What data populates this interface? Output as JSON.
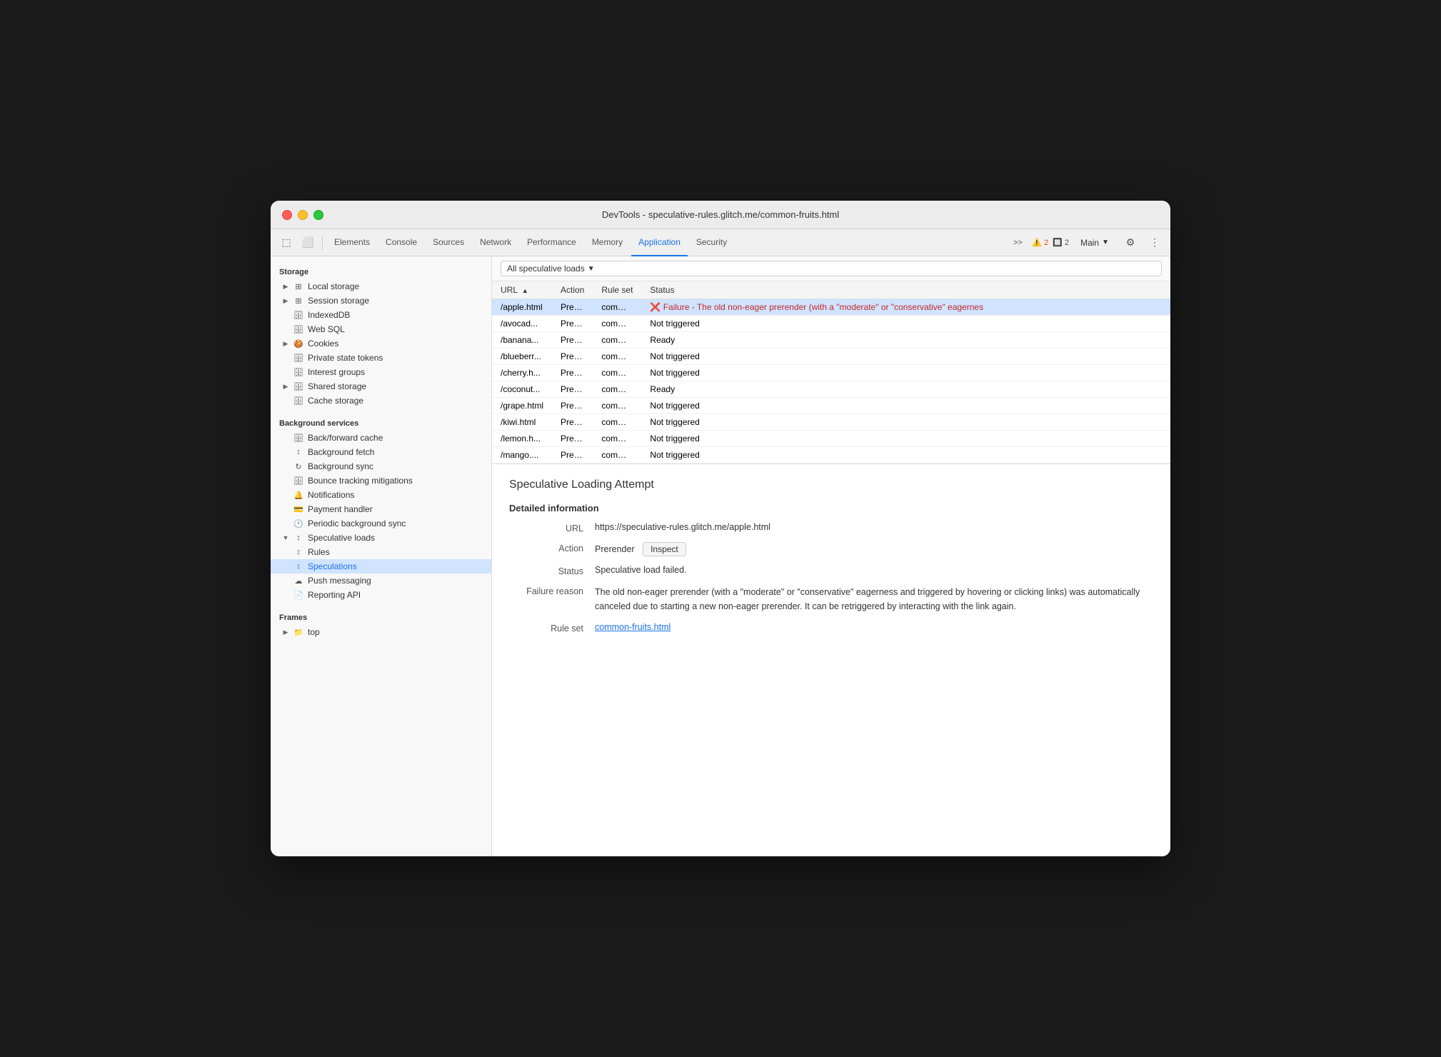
{
  "window": {
    "title": "DevTools - speculative-rules.glitch.me/common-fruits.html"
  },
  "toolbar": {
    "tabs": [
      {
        "id": "elements",
        "label": "Elements",
        "active": false
      },
      {
        "id": "console",
        "label": "Console",
        "active": false
      },
      {
        "id": "sources",
        "label": "Sources",
        "active": false
      },
      {
        "id": "network",
        "label": "Network",
        "active": false
      },
      {
        "id": "performance",
        "label": "Performance",
        "active": false
      },
      {
        "id": "memory",
        "label": "Memory",
        "active": false
      },
      {
        "id": "application",
        "label": "Application",
        "active": true
      },
      {
        "id": "security",
        "label": "Security",
        "active": false
      }
    ],
    "warnings_count": "2",
    "info_count": "2",
    "main_label": "Main",
    "more_tabs_label": ">>"
  },
  "sidebar": {
    "storage_header": "Storage",
    "background_services_header": "Background services",
    "frames_header": "Frames",
    "items": [
      {
        "id": "local-storage",
        "label": "Local storage",
        "icon": "table",
        "expandable": true,
        "indent": 0
      },
      {
        "id": "session-storage",
        "label": "Session storage",
        "icon": "table",
        "expandable": true,
        "indent": 0
      },
      {
        "id": "indexeddb",
        "label": "IndexedDB",
        "icon": "cylinder",
        "expandable": false,
        "indent": 0
      },
      {
        "id": "web-sql",
        "label": "Web SQL",
        "icon": "cylinder",
        "expandable": false,
        "indent": 0
      },
      {
        "id": "cookies",
        "label": "Cookies",
        "icon": "cookie",
        "expandable": true,
        "indent": 0
      },
      {
        "id": "private-state-tokens",
        "label": "Private state tokens",
        "icon": "cylinder",
        "expandable": false,
        "indent": 0
      },
      {
        "id": "interest-groups",
        "label": "Interest groups",
        "icon": "cylinder",
        "expandable": false,
        "indent": 0
      },
      {
        "id": "shared-storage",
        "label": "Shared storage",
        "icon": "cylinder",
        "expandable": true,
        "indent": 0
      },
      {
        "id": "cache-storage",
        "label": "Cache storage",
        "icon": "cylinder",
        "expandable": false,
        "indent": 0
      },
      {
        "id": "back-forward-cache",
        "label": "Back/forward cache",
        "icon": "cylinder",
        "indent": 0
      },
      {
        "id": "background-fetch",
        "label": "Background fetch",
        "icon": "arrow-up-down",
        "indent": 0
      },
      {
        "id": "background-sync",
        "label": "Background sync",
        "icon": "refresh",
        "indent": 0
      },
      {
        "id": "bounce-tracking",
        "label": "Bounce tracking mitigations",
        "icon": "cylinder",
        "indent": 0
      },
      {
        "id": "notifications",
        "label": "Notifications",
        "icon": "bell",
        "indent": 0
      },
      {
        "id": "payment-handler",
        "label": "Payment handler",
        "icon": "card",
        "indent": 0
      },
      {
        "id": "periodic-background-sync",
        "label": "Periodic background sync",
        "icon": "clock",
        "indent": 0
      },
      {
        "id": "speculative-loads",
        "label": "Speculative loads",
        "icon": "arrows",
        "expandable": true,
        "expanded": true,
        "indent": 0
      },
      {
        "id": "rules",
        "label": "Rules",
        "icon": "arrows",
        "indent": 1
      },
      {
        "id": "speculations",
        "label": "Speculations",
        "icon": "arrows",
        "indent": 1,
        "active": true
      },
      {
        "id": "push-messaging",
        "label": "Push messaging",
        "icon": "cloud",
        "indent": 0
      },
      {
        "id": "reporting-api",
        "label": "Reporting API",
        "icon": "file",
        "indent": 0
      },
      {
        "id": "top",
        "label": "top",
        "icon": "folder",
        "expandable": true,
        "indent": 0
      }
    ]
  },
  "content": {
    "filter_label": "All speculative loads",
    "table": {
      "columns": [
        "URL",
        "Action",
        "Rule set",
        "Status"
      ],
      "rows": [
        {
          "url": "/apple.html",
          "action": "Prerender",
          "ruleset": "common-fr...",
          "status": "❌ Failure - The old non-eager prerender (with a \"moderate\" or \"conservative\" eagernes",
          "selected": true,
          "error": true
        },
        {
          "url": "/avocad...",
          "action": "Prerender",
          "ruleset": "common-fr...",
          "status": "Not triggered",
          "selected": false,
          "error": false
        },
        {
          "url": "/banana...",
          "action": "Prerender",
          "ruleset": "common-fr...",
          "status": "Ready",
          "selected": false,
          "error": false
        },
        {
          "url": "/blueberr...",
          "action": "Prerender",
          "ruleset": "common-fr...",
          "status": "Not triggered",
          "selected": false,
          "error": false
        },
        {
          "url": "/cherry.h...",
          "action": "Prerender",
          "ruleset": "common-fr...",
          "status": "Not triggered",
          "selected": false,
          "error": false
        },
        {
          "url": "/coconut...",
          "action": "Prerender",
          "ruleset": "common-fr...",
          "status": "Ready",
          "selected": false,
          "error": false
        },
        {
          "url": "/grape.html",
          "action": "Prerender",
          "ruleset": "common-fr...",
          "status": "Not triggered",
          "selected": false,
          "error": false
        },
        {
          "url": "/kiwi.html",
          "action": "Prerender",
          "ruleset": "common-fr...",
          "status": "Not triggered",
          "selected": false,
          "error": false
        },
        {
          "url": "/lemon.h...",
          "action": "Prerender",
          "ruleset": "common-fr...",
          "status": "Not triggered",
          "selected": false,
          "error": false
        },
        {
          "url": "/mango....",
          "action": "Prerender",
          "ruleset": "common-fr...",
          "status": "Not triggered",
          "selected": false,
          "error": false
        }
      ]
    },
    "detail": {
      "title": "Speculative Loading Attempt",
      "section_title": "Detailed information",
      "fields": {
        "url_label": "URL",
        "url_value": "https://speculative-rules.glitch.me/apple.html",
        "action_label": "Action",
        "action_value": "Prerender",
        "inspect_label": "Inspect",
        "status_label": "Status",
        "status_value": "Speculative load failed.",
        "failure_label": "Failure reason",
        "failure_text": "The old non-eager prerender (with a \"moderate\" or \"conservative\" eagerness and triggered by hovering or clicking links) was automatically canceled due to starting a new non-eager prerender. It can be retriggered by interacting with the link again.",
        "ruleset_label": "Rule set",
        "ruleset_link": "common-fruits.html"
      }
    }
  }
}
